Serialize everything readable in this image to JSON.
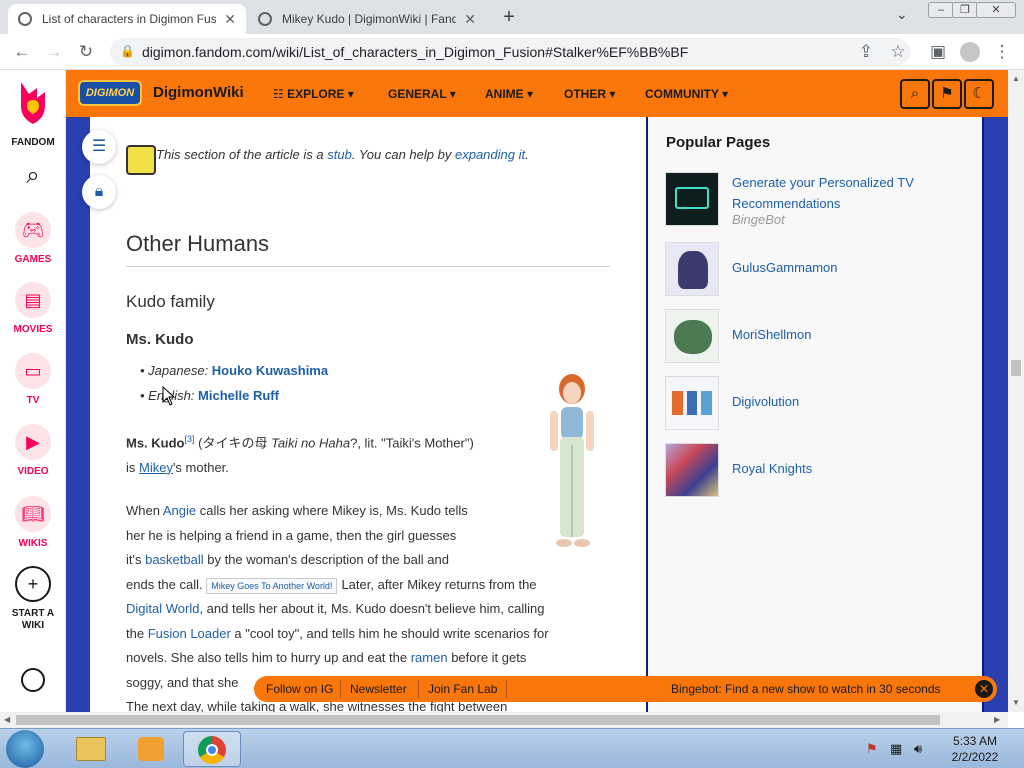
{
  "browser": {
    "tabs": [
      {
        "title": "List of characters in Digimon Fus",
        "active": true
      },
      {
        "title": "Mikey Kudo | DigimonWiki | Fand",
        "active": false
      }
    ],
    "url": "digimon.fandom.com/wiki/List_of_characters_in_Digimon_Fusion#Stalker%EF%BB%BF"
  },
  "rail": {
    "fandom": "FANDOM",
    "items": [
      {
        "label": "GAMES",
        "icon": "gamepad-icon"
      },
      {
        "label": "MOVIES",
        "icon": "clapper-icon"
      },
      {
        "label": "TV",
        "icon": "tv-icon"
      },
      {
        "label": "VIDEO",
        "icon": "play-icon"
      },
      {
        "label": "WIKIS",
        "icon": "book-icon"
      },
      {
        "label": "START A WIKI",
        "icon": "plus-icon"
      }
    ]
  },
  "wiki_header": {
    "logo": "DIGIMON",
    "name": "DigimonWiki",
    "nav": [
      "EXPLORE",
      "GENERAL",
      "ANIME",
      "OTHER",
      "COMMUNITY"
    ]
  },
  "article": {
    "stub_text": "This section of the article is a",
    "stub_link": "stub",
    "stub_mid": ". You can help by",
    "stub_link2": "expanding it",
    "h2": "Other Humans",
    "h3": "Kudo family",
    "h4": "Ms. Kudo",
    "japanese_label": "Japanese:",
    "japanese_va": "Houko Kuwashima",
    "english_label": "English:",
    "english_va": "Michelle Ruff",
    "p1_bold": "Ms. Kudo",
    "p1_ref": "[3]",
    "p1_text": " (タイキの母 ",
    "p1_italic": "Taiki no Haha",
    "p1_rest": "?, lit. \"Taiki's Mother\")",
    "p1_line2_pre": "is ",
    "p1_link": "Mikey",
    "p1_line2_post": "'s mother.",
    "p2": {
      "l1_pre": "When ",
      "l1_link": "Angie",
      "l1_post": " calls her asking where Mikey is, Ms. Kudo tells",
      "l2": "her he is helping a friend in a game, then the girl guesses",
      "l3_pre": "it's ",
      "l3_link": "basketball",
      "l3_post": " by the woman's description of the ball and",
      "l4_pre": "ends the call. ",
      "l4_chip": "Mikey Goes To Another World!",
      "l4_post": "Later, after Mikey returns from the",
      "l5_link": "Digital World",
      "l5_post": ", and tells her about it, Ms. Kudo doesn't believe him, calling",
      "l6_pre": "the ",
      "l6_link": "Fusion Loader",
      "l6_post": " a \"cool toy\", and tells him he should write scenarios for",
      "l7_pre": "novels. She also tells him to hurry up and eat the ",
      "l7_link": "ramen",
      "l7_post": " before it gets",
      "l8": "soggy, and that she",
      "l9": "The next day, while taking a walk, she witnesses the fight between"
    }
  },
  "sidebar": {
    "title": "Popular Pages",
    "items": [
      {
        "name": "Generate your Personalized TV Recommendations",
        "sub": "BingeBot"
      },
      {
        "name": "GulusGammamon"
      },
      {
        "name": "MoriShellmon"
      },
      {
        "name": "Digivolution"
      },
      {
        "name": "Royal Knights"
      }
    ]
  },
  "fanbar": {
    "items": [
      "Follow on IG",
      "Newsletter",
      "Join Fan Lab"
    ],
    "promo": "Bingebot: Find a new show to watch in 30 seconds"
  },
  "taskbar": {
    "time": "5:33 AM",
    "date": "2/2/2022"
  },
  "colors": {
    "fandom_orange": "#f9770a",
    "fandom_pink": "#fa005a",
    "link": "#1e5fa8",
    "wiki_bg": "#0e1a8a"
  }
}
